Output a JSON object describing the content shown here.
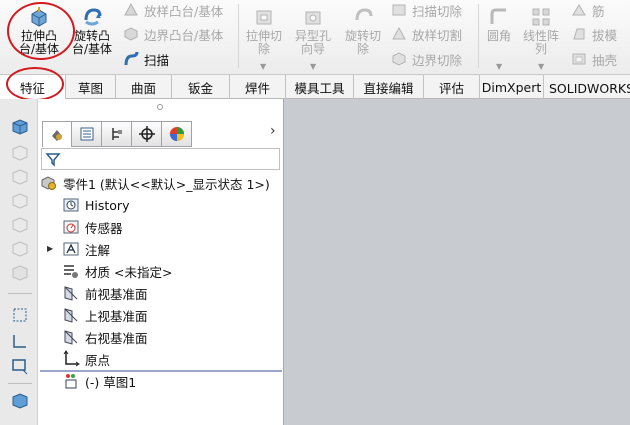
{
  "ribbon": {
    "extrude_boss": "拉伸凸\n台/基体",
    "revolve_boss": "旋转凸\n台/基体",
    "loft_boss": "放样凸台/基体",
    "boundary_boss": "边界凸台/基体",
    "sweep": "扫描",
    "extrude_cut": "拉伸切\n除",
    "hole_wizard": "异型孔\n向导",
    "revolve_cut": "旋转切\n除",
    "sweep_cut": "扫描切除",
    "loft_cut": "放样切割",
    "boundary_cut": "边界切除",
    "fillet": "圆角",
    "linear_pattern": "线性阵\n列",
    "rib": "筋",
    "draft": "拔模",
    "shell": "抽壳"
  },
  "tabs": [
    "特征",
    "草图",
    "曲面",
    "钣金",
    "焊件",
    "模具工具",
    "直接编辑",
    "评估",
    "DimXpert",
    "SOLIDWORKS 插"
  ],
  "tree": {
    "root": "零件1 (默认<<默认>_显示状态 1>)",
    "items": [
      "History",
      "传感器",
      "注解",
      "材质 <未指定>",
      "前视基准面",
      "上视基准面",
      "右视基准面",
      "原点",
      "(-) 草图1"
    ]
  },
  "colors": {
    "highlight_ring": "#d2191d",
    "active_tab": "#ffffff",
    "graphics_bg": "#c8cbcf"
  }
}
